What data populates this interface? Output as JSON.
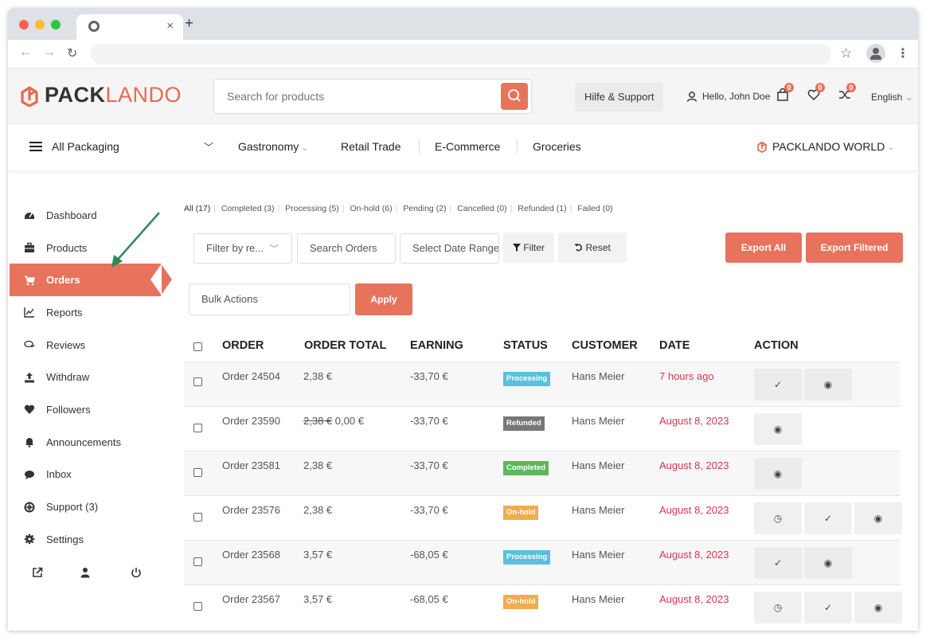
{
  "browser": {
    "tab_close": "×",
    "new_tab": "+"
  },
  "header": {
    "logo_pack": "PACK",
    "logo_lando": "LANDO",
    "search_placeholder": "Search for products",
    "help_label": "Hilfe & Support",
    "hello_label": "Hello, John Doe",
    "cart_count": "0",
    "wishlist_count": "0",
    "compare_count": "0",
    "language": "English"
  },
  "catnav": {
    "all_label": "All Packaging",
    "items": [
      "Gastronomy",
      "Retail Trade",
      "E-Commerce",
      "Groceries"
    ],
    "world_label": "PACKLANDO WORLD"
  },
  "sidebar": {
    "items": [
      {
        "label": "Dashboard",
        "icon": "dashboard-icon"
      },
      {
        "label": "Products",
        "icon": "briefcase-icon"
      },
      {
        "label": "Orders",
        "icon": "cart-icon"
      },
      {
        "label": "Reports",
        "icon": "chart-icon"
      },
      {
        "label": "Reviews",
        "icon": "comments-icon"
      },
      {
        "label": "Withdraw",
        "icon": "upload-icon"
      },
      {
        "label": "Followers",
        "icon": "heart-icon"
      },
      {
        "label": "Announcements",
        "icon": "bell-icon"
      },
      {
        "label": "Inbox",
        "icon": "chat-icon"
      },
      {
        "label": "Support (3)",
        "icon": "lifebuoy-icon"
      },
      {
        "label": "Settings",
        "icon": "gear-icon"
      }
    ]
  },
  "filters": {
    "tabs": [
      "All (17)",
      "Completed (3)",
      "Processing (5)",
      "On-hold (6)",
      "Pending (2)",
      "Cancelled (0)",
      "Refunded (1)",
      "Failed (0)"
    ]
  },
  "controls": {
    "filter_by": "Filter by re...",
    "search_orders": "Search Orders",
    "date_range": "Select Date Range",
    "filter_btn": "Filter",
    "reset_btn": "Reset",
    "export_all": "Export All",
    "export_filtered": "Export Filtered",
    "bulk_actions": "Bulk Actions",
    "apply": "Apply"
  },
  "table": {
    "headers": [
      "ORDER",
      "ORDER TOTAL",
      "EARNING",
      "STATUS",
      "CUSTOMER",
      "DATE",
      "ACTION"
    ],
    "rows": [
      {
        "order": "Order 24504",
        "total": "2,38 €",
        "total_old": "",
        "earning": "-33,70 €",
        "status": "Processing",
        "customer": "Hans Meier",
        "date": "7 hours ago"
      },
      {
        "order": "Order 23590",
        "total": "0,00 €",
        "total_old": "2,38 €",
        "earning": "-33,70 €",
        "status": "Refunded",
        "customer": "Hans Meier",
        "date": "August 8, 2023"
      },
      {
        "order": "Order 23581",
        "total": "2,38 €",
        "total_old": "",
        "earning": "-33,70 €",
        "status": "Completed",
        "customer": "Hans Meier",
        "date": "August 8, 2023"
      },
      {
        "order": "Order 23576",
        "total": "2,38 €",
        "total_old": "",
        "earning": "-33,70 €",
        "status": "On-hold",
        "customer": "Hans Meier",
        "date": "August 8, 2023"
      },
      {
        "order": "Order 23568",
        "total": "3,57 €",
        "total_old": "",
        "earning": "-68,05 €",
        "status": "Processing",
        "customer": "Hans Meier",
        "date": "August 8, 2023"
      },
      {
        "order": "Order 23567",
        "total": "3,57 €",
        "total_old": "",
        "earning": "-68,05 €",
        "status": "On-hold",
        "customer": "Hans Meier",
        "date": "August 8, 2023"
      }
    ]
  },
  "colors": {
    "accent": "#e8735d",
    "processing": "#5bc0de",
    "refunded": "#777777",
    "completed": "#5cb85c",
    "on_hold": "#f0ad4e",
    "date_red": "#d9364d",
    "arrow": "#2e8b57"
  }
}
